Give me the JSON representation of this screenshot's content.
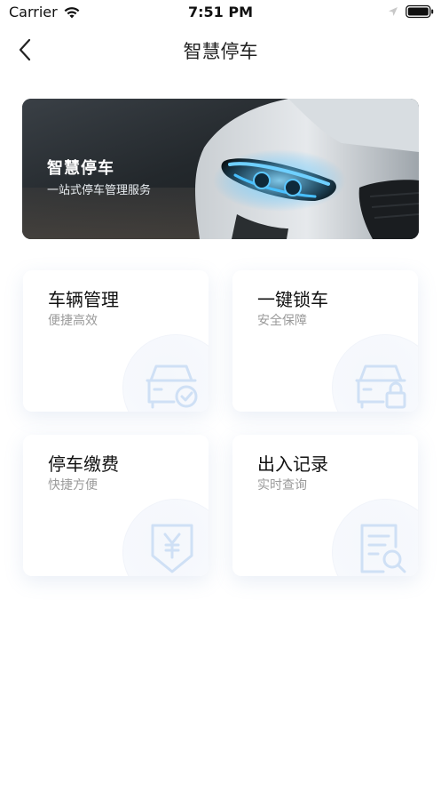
{
  "status_bar": {
    "carrier": "Carrier",
    "time": "7:51 PM"
  },
  "nav": {
    "title": "智慧停车",
    "back_icon": "chevron-left-icon"
  },
  "banner": {
    "title": "智慧停车",
    "subtitle": "一站式停车管理服务"
  },
  "cards": [
    {
      "title": "车辆管理",
      "subtitle": "便捷高效",
      "icon": "car-check-icon"
    },
    {
      "title": "一键锁车",
      "subtitle": "安全保障",
      "icon": "car-lock-icon"
    },
    {
      "title": "停车缴费",
      "subtitle": "快捷方便",
      "icon": "yen-payment-icon"
    },
    {
      "title": "出入记录",
      "subtitle": "实时查询",
      "icon": "document-search-icon"
    }
  ],
  "colors": {
    "icon_light_blue": "#cfe0f5",
    "subtitle_gray": "#9a9a9a",
    "headlight_blue": "#38b6ff"
  }
}
